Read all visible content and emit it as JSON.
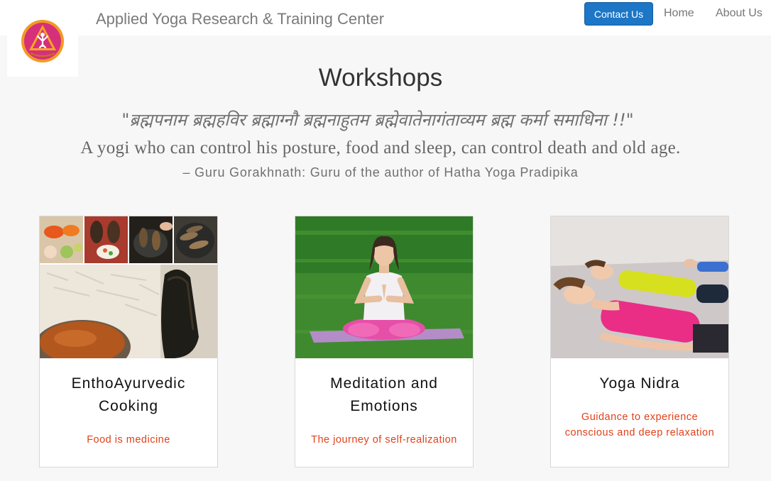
{
  "header": {
    "site_title": "Applied Yoga Research & Training Center",
    "logo_icon": "yoga-center-logo",
    "nav": {
      "contact_label": "Contact Us",
      "home_label": "Home",
      "about_label": "About Us"
    }
  },
  "main": {
    "heading": "Workshops",
    "sanskrit_quote": "\"ब्रह्मपनाम ब्रह्महविर ब्रह्माग्नौ ब्रह्मनाहुतम ब्रह्मेवातेनागंताव्यम ब्रह्म कर्मा समाधिना !!\"",
    "english_quote": "A yogi who can control his posture, food and sleep, can control death and old age.",
    "attribution": "– Guru Gorakhnath: Guru of the author of Hatha Yoga Pradipika"
  },
  "workshops": [
    {
      "title_line1": "EnthoAyurvedic",
      "title_line2": "Cooking",
      "subtitle": "Food is medicine",
      "image": "cooking-collage-image"
    },
    {
      "title_line1": "Meditation and",
      "title_line2": "Emotions",
      "subtitle": "The journey of self-realization",
      "image": "meditation-image"
    },
    {
      "title_line1": "Yoga Nidra",
      "subtitle_line1": "Guidance to experience",
      "subtitle_line2": "conscious and deep relaxation",
      "image": "yoga-nidra-image"
    }
  ],
  "colors": {
    "accent_button": "#1d76c6",
    "subtitle_red": "#e0411a",
    "logo_orange": "#f29a24",
    "logo_magenta": "#d6307b"
  }
}
